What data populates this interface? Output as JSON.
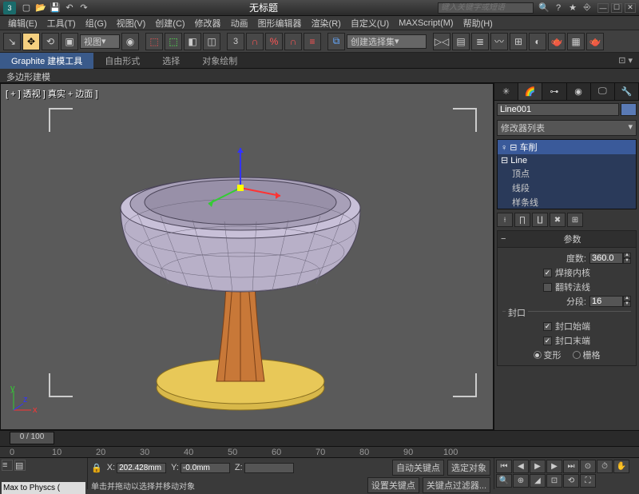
{
  "titlebar": {
    "title": "无标题",
    "search_placeholder": "键入关键字或短语"
  },
  "menubar": [
    "编辑(E)",
    "工具(T)",
    "组(G)",
    "视图(V)",
    "创建(C)",
    "修改器",
    "动画",
    "图形编辑器",
    "渲染(R)",
    "自定义(U)",
    "MAXScript(M)",
    "帮助(H)"
  ],
  "toolbar": {
    "view_combo": "视图",
    "angle": "3",
    "selset_combo": "创建选择集"
  },
  "ribbon": {
    "tabs": [
      "Graphite 建模工具",
      "自由形式",
      "选择",
      "对象绘制"
    ],
    "sub": "多边形建模"
  },
  "viewport": {
    "label": "[ + ] 透视 ] 真实 + 边面 ]"
  },
  "cmd": {
    "object_name": "Line001",
    "modlist_label": "修改器列表",
    "stack": {
      "lathe": "车削",
      "line": "Line",
      "vertex": "顶点",
      "segment": "线段",
      "spline": "样条线"
    },
    "rollout": {
      "params_title": "参数",
      "degrees_label": "度数:",
      "degrees_value": "360.0",
      "weld_core": "焊接内核",
      "flip_normals": "翻转法线",
      "segments_label": "分段:",
      "segments_value": "16",
      "capping_group": "封口",
      "cap_start": "封口始端",
      "cap_end": "封口末端",
      "morph": "变形",
      "grid": "栅格"
    }
  },
  "timeline": {
    "frame": "0 / 100",
    "ticks": [
      "0",
      "10",
      "20",
      "30",
      "40",
      "50",
      "60",
      "70",
      "80",
      "90",
      "100"
    ]
  },
  "statusbar": {
    "script": "Max to Physcs (",
    "x_label": "X:",
    "x": "202.428mm",
    "y_label": "Y:",
    "y": "-0.0mm",
    "z_label": "Z:",
    "z": "",
    "prompt": "单击并拖动以选择并移动对象",
    "autokey": "自动关键点",
    "selected": "选定对象",
    "setkey": "设置关键点",
    "keyfilter": "关键点过滤器..."
  }
}
